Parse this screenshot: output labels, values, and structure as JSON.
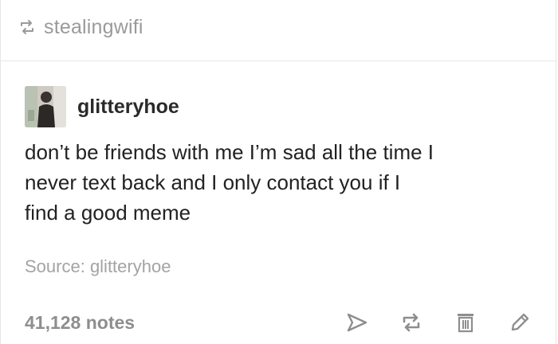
{
  "reblog": {
    "username": "stealingwifi",
    "icon": "reblog-icon"
  },
  "post": {
    "author": "glitteryhoe",
    "body_lines": [
      "don’t be friends with me I’m sad all the time I",
      "never text back and I only contact you if I",
      "find a good meme"
    ],
    "source_label": "Source: ",
    "source_user": "glitteryhoe"
  },
  "footer": {
    "notes": "41,128 notes",
    "actions": [
      "share-icon",
      "reblog-icon",
      "delete-icon",
      "edit-icon"
    ]
  },
  "colors": {
    "muted_text": "#9a9a9a",
    "body_text": "#222222",
    "icon_gray": "#8e8e8e",
    "divider": "#e7e7e7"
  }
}
